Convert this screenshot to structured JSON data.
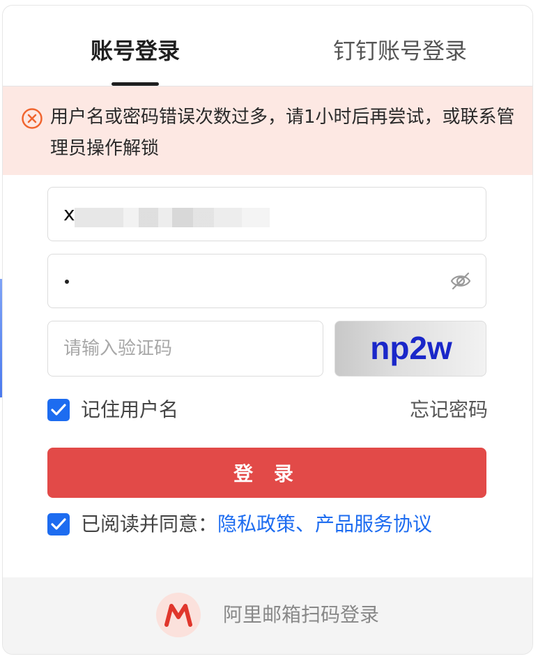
{
  "tabs": {
    "active_label": "账号登录",
    "inactive_label": "钉钉账号登录"
  },
  "alert": {
    "message": "用户名或密码错误次数过多，请1小时后再尝试，或联系管理员操作解锁",
    "color": "#fde8e3",
    "icon": "close-circle-icon"
  },
  "form": {
    "username_value": "x",
    "password_value": "•",
    "captcha_placeholder": "请输入验证码",
    "captcha_image_text": "np2w",
    "remember_label": "记住用户名",
    "remember_checked": true,
    "forgot_label": "忘记密码",
    "login_label": "登 录",
    "agree_prefix": "已阅读并同意：",
    "agree_links": "隐私政策、产品服务协议",
    "agree_checked": true
  },
  "footer": {
    "qr_login_label": "阿里邮箱扫码登录",
    "logo_letter": "M"
  },
  "colors": {
    "primary": "#e24a48",
    "link": "#1d6cf0",
    "checkbox": "#1d6cf0"
  }
}
